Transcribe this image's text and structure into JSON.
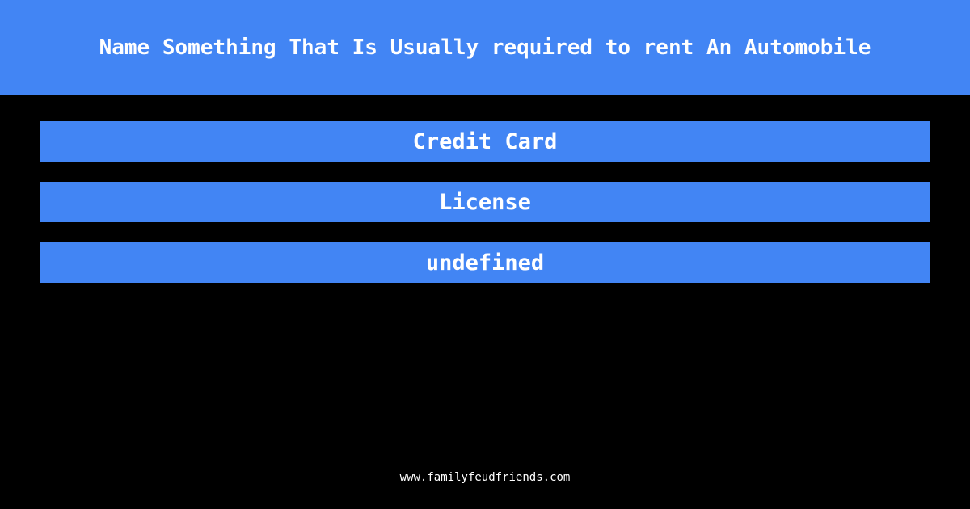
{
  "colors": {
    "background": "#000000",
    "accent": "#4285f4",
    "text_on_accent": "#ffffff",
    "footer_text": "#ffffff"
  },
  "header": {
    "question": "Name Something That Is Usually required to rent An Automobile"
  },
  "answers": [
    {
      "label": "Credit Card"
    },
    {
      "label": "License"
    },
    {
      "label": "undefined"
    }
  ],
  "footer": {
    "site": "www.familyfeudfriends.com"
  }
}
